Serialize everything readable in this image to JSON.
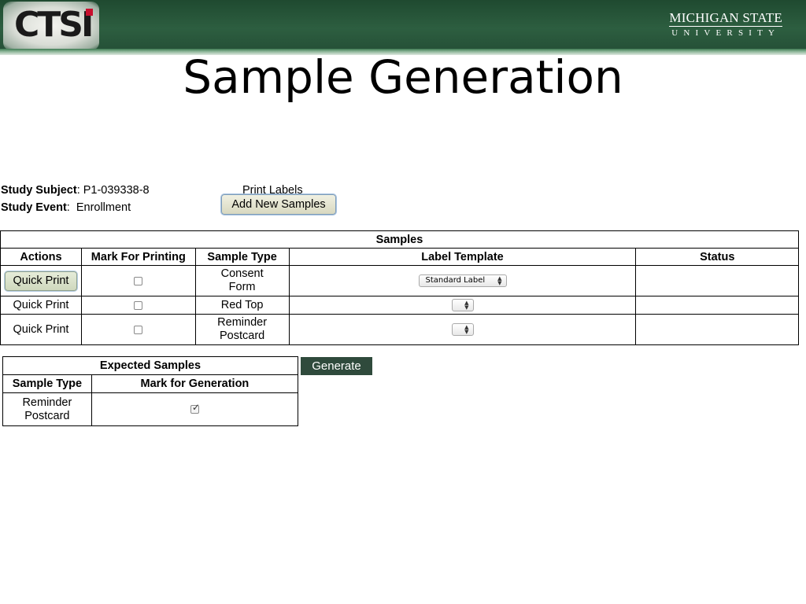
{
  "header": {
    "logo_text": "CTSI",
    "university_line1": "MICHIGAN STATE",
    "university_line2": "UNIVERSITY",
    "brand_green": "#2d5e40"
  },
  "page_title": "Sample Generation",
  "study": {
    "subject_label": "Study Subject",
    "subject_value": ": P1-039338-8",
    "event_label": "Study Event",
    "event_value": "Enrollment"
  },
  "actions": {
    "print_labels": "Print Labels",
    "add_new_samples": "Add New Samples",
    "generate": "Generate"
  },
  "samples_table": {
    "caption": "Samples",
    "columns": [
      "Actions",
      "Mark For Printing",
      "Sample Type",
      "Label Template",
      "Status"
    ],
    "rows": [
      {
        "action": "Quick Print",
        "marked": false,
        "type_line1": "Consent",
        "type_line2": "Form",
        "template": "Standard Label",
        "status": ""
      },
      {
        "action": "Quick Print",
        "marked": false,
        "type_line1": "Red Top",
        "type_line2": "",
        "template": "",
        "status": ""
      },
      {
        "action": "Quick Print",
        "marked": false,
        "type_line1": "Reminder",
        "type_line2": "Postcard",
        "template": "",
        "status": ""
      }
    ]
  },
  "expected_table": {
    "caption": "Expected Samples",
    "columns": [
      "Sample Type",
      "Mark for Generation"
    ],
    "rows": [
      {
        "type_line1": "Reminder",
        "type_line2": "Postcard",
        "marked": true
      }
    ]
  }
}
